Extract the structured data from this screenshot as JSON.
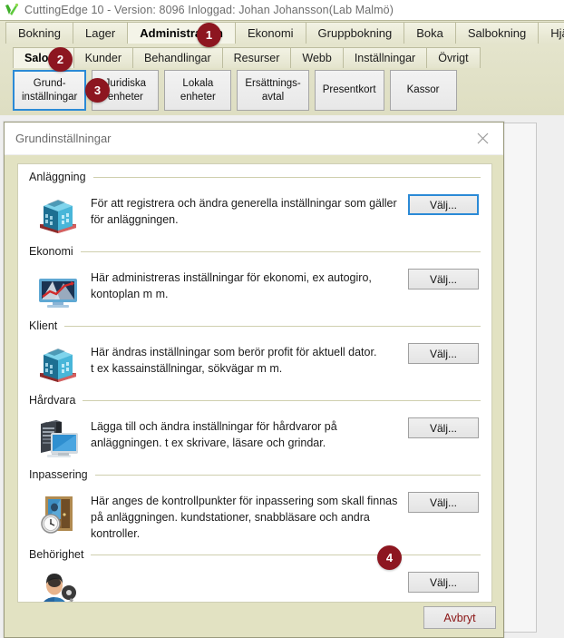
{
  "titlebar": {
    "logo_icon": "green-leaf-checkmark-logo",
    "title": "CuttingEdge 10 - Version: 8096 Inloggad: Johan Johansson(Lab Malmö)"
  },
  "main_tabs": [
    {
      "label": "Bokning",
      "active": false
    },
    {
      "label": "Lager",
      "active": false
    },
    {
      "label": "Administration",
      "active": true
    },
    {
      "label": "Ekonomi",
      "active": false
    },
    {
      "label": "Gruppbokning",
      "active": false
    },
    {
      "label": "Boka",
      "active": false
    },
    {
      "label": "Salbokning",
      "active": false
    },
    {
      "label": "Hjälp",
      "active": false
    }
  ],
  "sub_tabs": [
    {
      "label": "Salong",
      "active": true
    },
    {
      "label": "Kunder",
      "active": false
    },
    {
      "label": "Behandlingar",
      "active": false
    },
    {
      "label": "Resurser",
      "active": false
    },
    {
      "label": "Webb",
      "active": false
    },
    {
      "label": "Inställningar",
      "active": false
    },
    {
      "label": "Övrigt",
      "active": false
    }
  ],
  "toolbar_buttons": [
    {
      "label": "Grund-\ninställningar",
      "selected": true
    },
    {
      "label": "Juridiska\nenheter",
      "selected": false
    },
    {
      "label": "Lokala\nenheter",
      "selected": false
    },
    {
      "label": "Ersättnings-\navtal",
      "selected": false
    },
    {
      "label": "Presentkort",
      "selected": false
    },
    {
      "label": "Kassor",
      "selected": false
    }
  ],
  "dialog": {
    "title": "Grundinställningar",
    "close_icon": "close-icon",
    "sections": [
      {
        "title": "Anläggning",
        "icon": "building-icon",
        "description": "För att registrera och ändra generella inställningar som gäller för anläggningen.",
        "button_label": "Välj...",
        "button_focused": true
      },
      {
        "title": "Ekonomi",
        "icon": "monitor-chart-icon",
        "description": "Här administreras inställningar för ekonomi, ex autogiro, kontoplan m m.",
        "button_label": "Välj...",
        "button_focused": false
      },
      {
        "title": "Klient",
        "icon": "building-icon",
        "description": "Här ändras inställningar som berör profit för aktuell dator.\nt ex kassainställningar, sökvägar m m.",
        "button_label": "Välj...",
        "button_focused": false
      },
      {
        "title": "Hårdvara",
        "icon": "server-monitor-icon",
        "description": "Lägga till och ändra inställningar för hårdvaror på anläggningen. t ex skrivare, läsare och grindar.",
        "button_label": "Välj...",
        "button_focused": false
      },
      {
        "title": "Inpassering",
        "icon": "door-clock-icon",
        "description": "Här anges de kontrollpunkter för inpassering som skall finnas på anläggningen. kundstationer, snabbläsare och andra kontroller.",
        "button_label": "Välj...",
        "button_focused": false
      },
      {
        "title": "Behörighet",
        "icon": "user-key-icon",
        "description": "",
        "button_label": "Välj...",
        "button_focused": false
      }
    ],
    "cancel_label": "Avbryt"
  },
  "badges": [
    {
      "number": "1"
    },
    {
      "number": "2"
    },
    {
      "number": "3"
    },
    {
      "number": "4"
    }
  ],
  "colors": {
    "ribbon_bg": "#e2e2c8",
    "dialog_bg": "#e2e2c2",
    "badge": "#8d1620",
    "focus_blue": "#2b8ad6",
    "cancel_text": "#8a1414"
  }
}
